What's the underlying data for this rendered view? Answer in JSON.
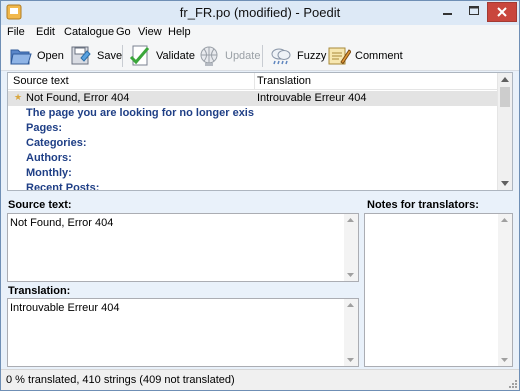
{
  "window": {
    "title": "fr_FR.po (modified) - Poedit"
  },
  "menu": [
    "File",
    "Edit",
    "Catalogue",
    "Go",
    "View",
    "Help"
  ],
  "toolbar": {
    "open": "Open",
    "save": "Save",
    "validate": "Validate",
    "update": "Update",
    "fuzzy": "Fuzzy",
    "comment": "Comment"
  },
  "list": {
    "header_source": "Source text",
    "header_translation": "Translation",
    "rows": [
      {
        "source": "Not Found, Error 404",
        "translation": "Introuvable Erreur 404",
        "selected": true
      },
      {
        "source": "The page you are looking for no longer exists. Perh...",
        "translation": ""
      },
      {
        "source": "Pages:",
        "translation": ""
      },
      {
        "source": "Categories:",
        "translation": ""
      },
      {
        "source": "Authors:",
        "translation": ""
      },
      {
        "source": "Monthly:",
        "translation": ""
      },
      {
        "source": "Recent Posts:",
        "translation": ""
      }
    ]
  },
  "editor": {
    "source_label": "Source text:",
    "source_value": "Not Found, Error 404",
    "translation_label": "Translation:",
    "translation_value": "Introuvable Erreur 404",
    "notes_label": "Notes for translators:"
  },
  "status": {
    "text": "0 % translated, 410 strings (409 not translated)"
  },
  "colors": {
    "accent": "#1f3f86",
    "close": "#c9463d",
    "star": "#d9a63d"
  }
}
